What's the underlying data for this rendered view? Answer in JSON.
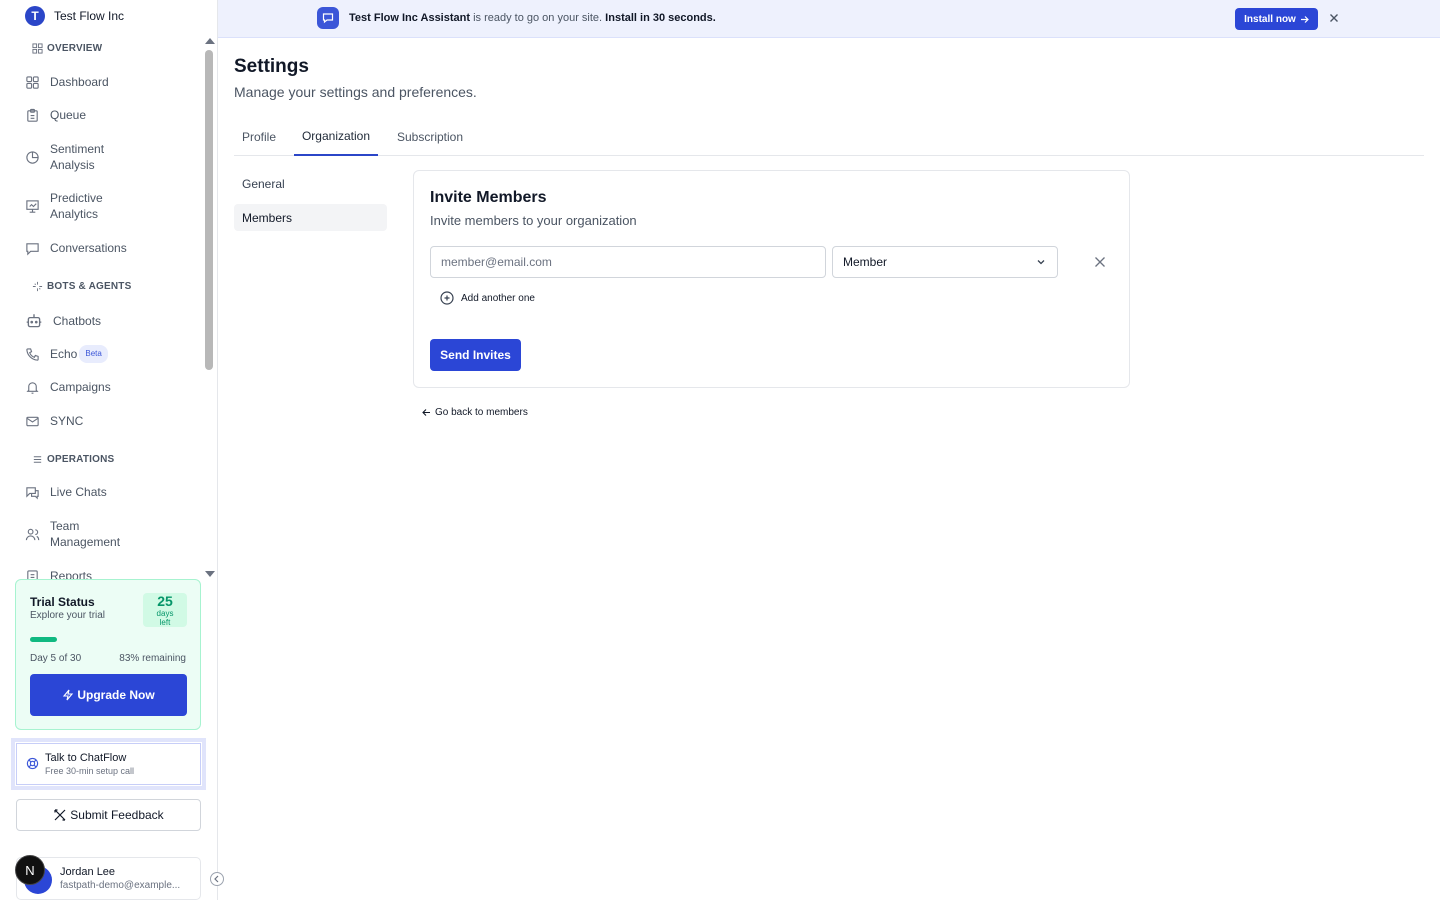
{
  "org": {
    "logo_letter": "T",
    "name": "Test Flow Inc"
  },
  "sidebar": {
    "sections": [
      {
        "title": "OVERVIEW",
        "icon": "layout-icon"
      },
      {
        "title": "BOTS & AGENTS",
        "icon": "sparkle-icon"
      },
      {
        "title": "OPERATIONS",
        "icon": "list-icon"
      }
    ],
    "items": [
      {
        "label": "Dashboard",
        "icon": "grid-icon"
      },
      {
        "label": "Queue",
        "icon": "clipboard-icon"
      },
      {
        "label": "Sentiment Analysis",
        "icon": "pie-chart-icon"
      },
      {
        "label": "Predictive Analytics",
        "icon": "presentation-icon"
      },
      {
        "label": "Conversations",
        "icon": "chat-bubble-icon"
      },
      {
        "label": "Chatbots",
        "icon": "bot-icon"
      },
      {
        "label": "Echo",
        "icon": "phone-icon",
        "badge": "Beta"
      },
      {
        "label": "Campaigns",
        "icon": "bell-icon"
      },
      {
        "label": "SYNC",
        "icon": "mail-icon"
      },
      {
        "label": "Live Chats",
        "icon": "chats-icon"
      },
      {
        "label": "Team Management",
        "icon": "users-icon"
      },
      {
        "label": "Reports",
        "icon": "report-icon"
      }
    ]
  },
  "trial": {
    "title": "Trial Status",
    "subtitle": "Explore your trial",
    "days_number": "25",
    "days_label": "days left",
    "progress_fraction": 0.17,
    "day_text": "Day 5 of 30",
    "remaining_text": "83% remaining",
    "upgrade_label": "Upgrade Now"
  },
  "talk": {
    "title": "Talk to ChatFlow",
    "subtitle": "Free 30-min setup call"
  },
  "feedback": {
    "label": "Submit Feedback"
  },
  "user": {
    "name": "Jordan Lee",
    "email": "fastpath-demo@example...",
    "badge_letter": "N"
  },
  "banner": {
    "bold_name": "Test Flow Inc Assistant",
    "middle_text": " is ready to go on your site. ",
    "bold_cta": "Install in 30 seconds.",
    "install_label": "Install now"
  },
  "page": {
    "title": "Settings",
    "subtitle": "Manage your settings and preferences.",
    "tabs": [
      "Profile",
      "Organization",
      "Subscription"
    ],
    "active_tab": "Organization"
  },
  "subnav": {
    "items": [
      "General",
      "Members"
    ],
    "active": "Members"
  },
  "invite": {
    "title": "Invite Members",
    "subtitle": "Invite members to your organization",
    "email_value": "",
    "email_placeholder": "member@email.com",
    "role_value": "Member",
    "add_another_label": "Add another one",
    "send_label": "Send Invites"
  },
  "back_link": {
    "label": "Go back to members"
  },
  "colors": {
    "primary": "#2b46d6",
    "trial_green": "#10b981",
    "banner_bg": "#eef1fd"
  }
}
